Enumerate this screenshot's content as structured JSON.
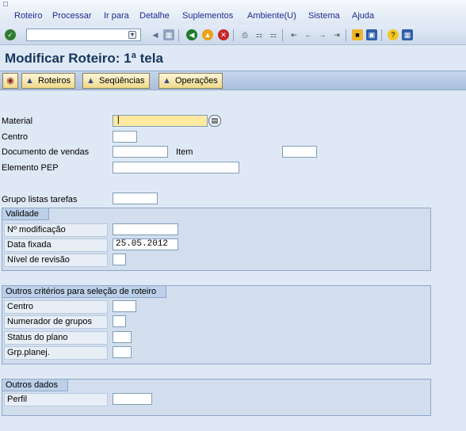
{
  "menu": {
    "items": [
      {
        "label": "Roteiro"
      },
      {
        "label": "Processar"
      },
      {
        "label": "Ir para"
      },
      {
        "label": "Detalhe"
      },
      {
        "label": "Suplementos"
      },
      {
        "label": "Ambiente(U)"
      },
      {
        "label": "Sistema"
      },
      {
        "label": "Ajuda"
      }
    ]
  },
  "toolbar": {
    "command_value": ""
  },
  "title": "Modificar Roteiro: 1ª tela",
  "app_toolbar": {
    "roteiros": "Roteiros",
    "sequencias": "Seqüências",
    "operacoes": "Operações"
  },
  "form": {
    "material_label": "Material",
    "material_value": "|",
    "centro_label": "Centro",
    "centro_value": "",
    "doc_vendas_label": "Documento de vendas",
    "doc_vendas_value": "",
    "item_label": "Item",
    "item_value": "",
    "elemento_pep_label": "Elemento PEP",
    "elemento_pep_value": "",
    "grupo_listas_label": "Grupo listas tarefas",
    "grupo_listas_value": ""
  },
  "validade": {
    "title": "Validade",
    "n_modificacao_label": "Nº modificação",
    "n_modificacao_value": "",
    "data_fixada_label": "Data fixada",
    "data_fixada_value": "25.05.2012",
    "nivel_revisao_label": "Nível de revisão",
    "nivel_revisao_value": ""
  },
  "outros_criterios": {
    "title": "Outros critérios para seleção de roteiro",
    "centro_label": "Centro",
    "centro_value": "",
    "numerador_label": "Numerador de grupos",
    "numerador_value": "",
    "status_label": "Status do plano",
    "status_value": "",
    "grp_planej_label": "Grp.planej.",
    "grp_planej_value": ""
  },
  "outros_dados": {
    "title": "Outros dados",
    "perfil_label": "Perfil",
    "perfil_value": ""
  }
}
